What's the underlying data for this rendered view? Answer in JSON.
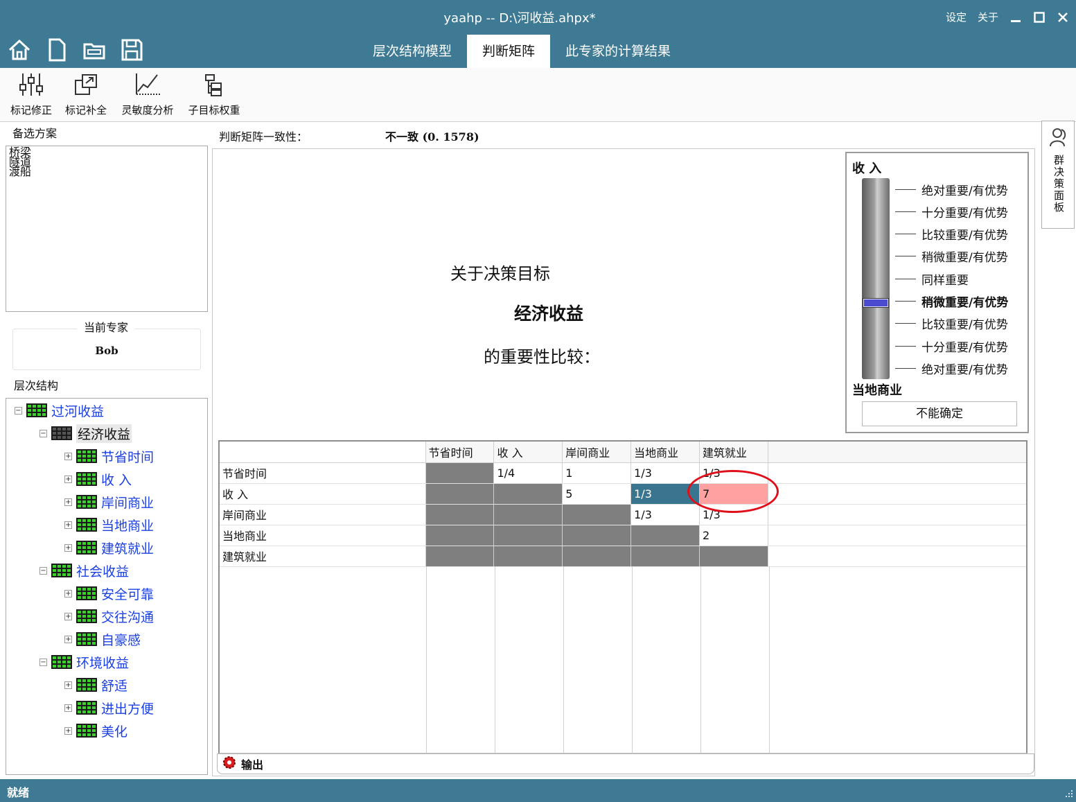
{
  "window": {
    "title": "yaahp -- D:\\河收益.ahpx*",
    "settings": "设定",
    "about": "关于"
  },
  "tabs": [
    {
      "label": "层次结构模型"
    },
    {
      "label": "判断矩阵"
    },
    {
      "label": "此专家的计算结果"
    }
  ],
  "ribbon": [
    {
      "label": "标记修正"
    },
    {
      "label": "标记补全"
    },
    {
      "label": "灵敏度分析"
    },
    {
      "label": "子目标权重"
    }
  ],
  "left": {
    "alternatives_title": "备选方案",
    "alternatives": [
      "桥梁",
      "隧道",
      "渡船"
    ],
    "expert_legend": "当前专家",
    "expert_name": "Bob",
    "hierarchy_title": "层次结构"
  },
  "tree": [
    {
      "label": "过河收益",
      "level": 0
    },
    {
      "label": "经济收益",
      "level": 1
    },
    {
      "label": "节省时间",
      "level": 2
    },
    {
      "label": "收 入",
      "level": 2
    },
    {
      "label": "岸间商业",
      "level": 2
    },
    {
      "label": "当地商业",
      "level": 2
    },
    {
      "label": "建筑就业",
      "level": 2
    },
    {
      "label": "社会收益",
      "level": 1
    },
    {
      "label": "安全可靠",
      "level": 2
    },
    {
      "label": "交往沟通",
      "level": 2
    },
    {
      "label": "自豪感",
      "level": 2
    },
    {
      "label": "环境收益",
      "level": 1
    },
    {
      "label": "舒适",
      "level": 2
    },
    {
      "label": "进出方便",
      "level": 2
    },
    {
      "label": "美化",
      "level": 2
    }
  ],
  "main": {
    "consistency_label": "判断矩阵一致性：",
    "consistency_value": "不一致 (0. 1578)",
    "goal_prefix": "关于决策目标",
    "goal_name": "经济收益",
    "goal_suffix": "的重要性比较："
  },
  "scale": {
    "top_label": "收 入",
    "bottom_label": "当地商业",
    "levels": [
      "绝对重要/有优势",
      "十分重要/有优势",
      "比较重要/有优势",
      "稍微重要/有优势",
      "同样重要",
      "稍微重要/有优势",
      "比较重要/有优势",
      "十分重要/有优势",
      "绝对重要/有优势"
    ],
    "selected_level": 5,
    "uncertain_button": "不能确定"
  },
  "matrix": {
    "columns": [
      "节省时间",
      "收 入",
      "岸间商业",
      "当地商业",
      "建筑就业"
    ],
    "rows": [
      {
        "label": "节省时间",
        "cells": [
          "",
          "1/4",
          "1",
          "1/3",
          "1/3"
        ]
      },
      {
        "label": "收 入",
        "cells": [
          "",
          "",
          "5",
          "1/3",
          "7"
        ]
      },
      {
        "label": "岸间商业",
        "cells": [
          "",
          "",
          "",
          "1/3",
          "1/3"
        ]
      },
      {
        "label": "当地商业",
        "cells": [
          "",
          "",
          "",
          "",
          "2"
        ]
      },
      {
        "label": "建筑就业",
        "cells": [
          "",
          "",
          "",
          "",
          ""
        ]
      }
    ]
  },
  "output_label": "输出",
  "side_tab_label": "群决策面板",
  "status": "就绪",
  "colors": {
    "title_bar": "#3e7a93",
    "selected_cell": "#3a7590",
    "highlight_cell": "#ffa1a1",
    "annotation": "#e0101a",
    "tree_text": "#1a3fe0"
  }
}
